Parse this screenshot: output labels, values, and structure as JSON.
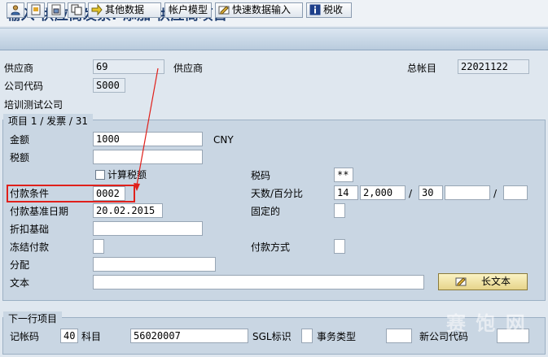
{
  "window": {
    "title": "输入 供应商发票: 添加 供应商项目"
  },
  "toolbar": {
    "other_data_label": "其他数据",
    "account_model_label": "帐户模型",
    "fast_entry_label": "快速数据输入",
    "tax_label": "税收"
  },
  "header": {
    "vendor_label": "供应商",
    "vendor_value": "69",
    "vendor_desc": "供应商",
    "gl_account_label": "总帐目",
    "gl_account_value": "22021122",
    "company_code_label": "公司代码",
    "company_code_value": "S000",
    "company_name": "培训测试公司"
  },
  "item_group": {
    "title": "项目 1 / 发票 / 31",
    "amount_label": "金额",
    "amount_value": "1000",
    "currency": "CNY",
    "tax_amount_label": "税额",
    "tax_amount_value": "",
    "calc_tax_label": "计算税额",
    "tax_code_label": "税码",
    "tax_code_value": "**",
    "payment_terms_label": "付款条件",
    "payment_terms_value": "0002",
    "days_pct_label": "天数/百分比",
    "days1": "14",
    "pct1": "2,000",
    "slash1": "/",
    "days2": "30",
    "pct2": "",
    "slash2": "/",
    "days3": "",
    "baseline_date_label": "付款基准日期",
    "baseline_date_value": "20.02.2015",
    "fixed_label": "固定的",
    "discount_base_label": "折扣基础",
    "discount_base_value": "",
    "payment_block_label": "冻结付款",
    "payment_method_label": "付款方式",
    "assignment_label": "分配",
    "assignment_value": "",
    "text_label": "文本",
    "text_value": "",
    "long_text_label": "长文本"
  },
  "next_item_group": {
    "title": "下一行项目",
    "posting_key_label": "记帐码",
    "posting_key_value": "40",
    "account_label": "科目",
    "account_value": "56020007",
    "sgl_label": "SGL标识",
    "trans_type_label": "事务类型",
    "new_company_code_label": "新公司代码"
  },
  "watermark": {
    "text": "赛 饱 网"
  },
  "colors": {
    "highlight_red": "#e0201b",
    "title_blue": "#1c3b6e"
  }
}
